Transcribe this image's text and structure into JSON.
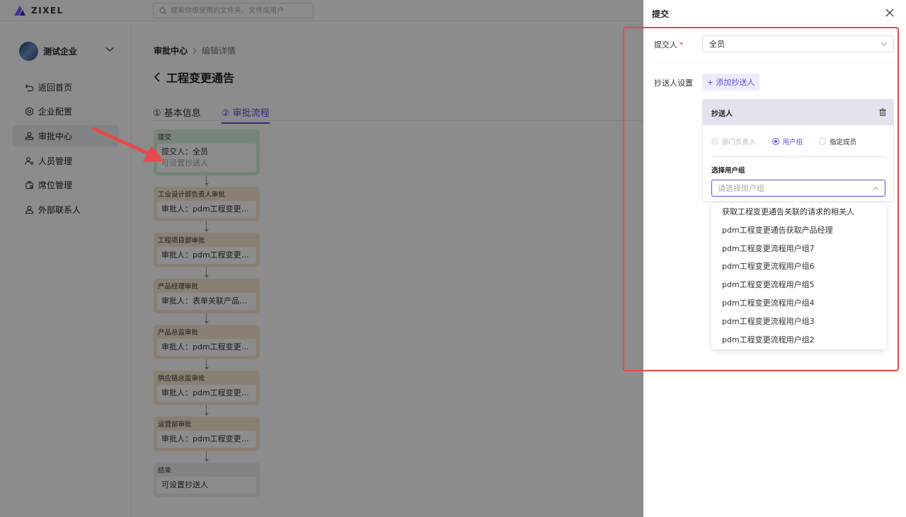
{
  "header": {
    "logo_text": "ZIXEL",
    "search_placeholder": "搜索你想使用的文件夹、文件或用户"
  },
  "sidebar": {
    "company_name": "测试企业",
    "items": [
      {
        "label": "返回首页",
        "icon": "back-icon"
      },
      {
        "label": "企业配置",
        "icon": "gear-icon"
      },
      {
        "label": "审批中心",
        "icon": "approval-icon",
        "active": true
      },
      {
        "label": "人员管理",
        "icon": "users-icon"
      },
      {
        "label": "席位管理",
        "icon": "seat-icon"
      },
      {
        "label": "外部联系人",
        "icon": "contact-icon"
      }
    ]
  },
  "main": {
    "breadcrumb": [
      "审批中心",
      "编辑详情"
    ],
    "title": "工程变更通告",
    "tabs": [
      {
        "label": "① 基本信息"
      },
      {
        "label": "② 审批流程",
        "active": true
      }
    ],
    "flow": [
      {
        "title": "提交",
        "line1": "提交人：全员",
        "line2": "可设置抄送人",
        "color": "green"
      },
      {
        "title": "工业设计部负责人审批",
        "line1": "审批人：pdm工程变更流程用户组",
        "color": "orange"
      },
      {
        "title": "工程项目部审批",
        "line1": "审批人：pdm工程变更流程用户组",
        "color": "orange"
      },
      {
        "title": "产品经理审批",
        "line1": "审批人：表单关联产品经理",
        "color": "orange"
      },
      {
        "title": "产品总监审批",
        "line1": "审批人：pdm工程变更流程用户组",
        "color": "orange"
      },
      {
        "title": "供应链总监审批",
        "line1": "审批人：pdm工程变更流程用户组",
        "color": "orange"
      },
      {
        "title": "运营部审批",
        "line1": "审批人：pdm工程变更流程用户组",
        "color": "orange"
      },
      {
        "title": "结束",
        "line1": "可设置抄送人",
        "color": "gray"
      }
    ]
  },
  "drawer": {
    "title": "提交",
    "submitter_label": "提交人",
    "required_mark": "*",
    "submitter_value": "全员",
    "cc_settings_label": "抄送人设置",
    "add_cc_label": "+ 添加抄送人",
    "cc_card": {
      "title": "抄送人",
      "options": [
        {
          "label": "部门负责人",
          "state": "disabled"
        },
        {
          "label": "用户组",
          "state": "checked"
        },
        {
          "label": "指定成员",
          "state": "normal"
        }
      ],
      "group_label": "选择用户组",
      "group_placeholder": "请选择用户组"
    },
    "dropdown_options": [
      "获取工程变更通告关联的请求的相关人",
      "pdm工程变更通告获取产品经理",
      "pdm工程变更流程用户组7",
      "pdm工程变更流程用户组6",
      "pdm工程变更流程用户组5",
      "pdm工程变更流程用户组4",
      "pdm工程变更流程用户组3",
      "pdm工程变更流程用户组2"
    ]
  },
  "colors": {
    "accent": "#5b4fd6",
    "highlight": "#e8484c",
    "node_green": "#d9f0dc",
    "node_orange": "#fbe7d2"
  }
}
